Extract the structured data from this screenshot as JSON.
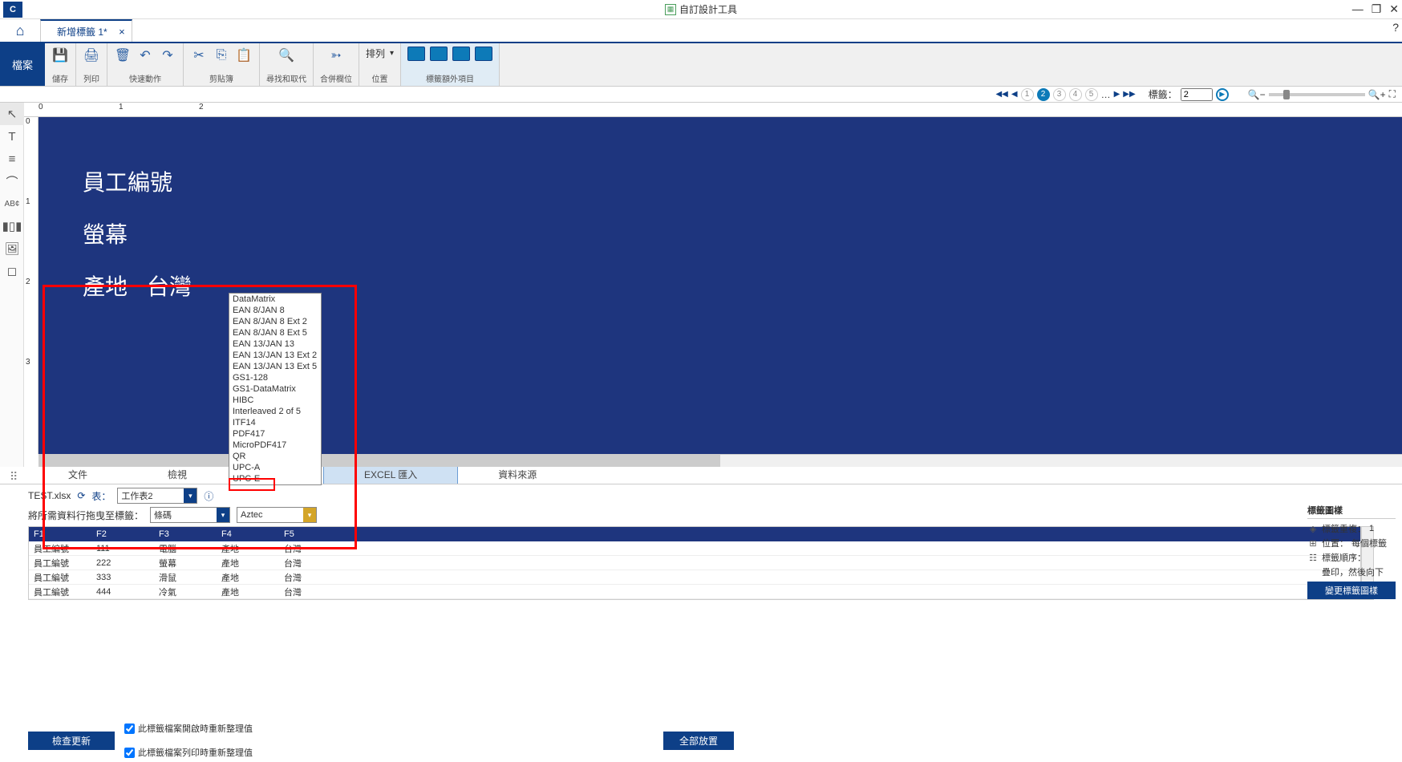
{
  "titlebar": {
    "app_logo": "C",
    "title": "自訂設計工具"
  },
  "tabs": {
    "doc_tab": "新增標籤 1*"
  },
  "ribbon": {
    "file": "檔案",
    "groups": {
      "save": "儲存",
      "print": "列印",
      "quick": "快速動作",
      "clip": "剪貼簿",
      "findrepl": "尋找和取代",
      "merge": "合併欄位",
      "arrange": "排列",
      "pos": "位置",
      "extra": "標籤額外項目"
    }
  },
  "navbar": {
    "label_prompt": "標籤：",
    "label_value": "2"
  },
  "canvas": {
    "text1": "員工編號",
    "text2": "螢幕",
    "text3": "產地",
    "text4": "台灣"
  },
  "barcode_dropdown": {
    "selected": "Aztec",
    "options": [
      "DataMatrix",
      "EAN 8/JAN 8",
      "EAN 8/JAN 8 Ext 2",
      "EAN 8/JAN 8 Ext 5",
      "EAN 13/JAN 13",
      "EAN 13/JAN 13 Ext 2",
      "EAN 13/JAN 13 Ext 5",
      "GS1-128",
      "GS1-DataMatrix",
      "HIBC",
      "Interleaved 2 of 5",
      "ITF14",
      "PDF417",
      "MicroPDF417",
      "QR",
      "UPC-A",
      "UPC-E"
    ]
  },
  "bottom_tabs": {
    "t0": "文件",
    "t1": "檢視",
    "t2_active": "EXCEL 匯入",
    "t3": "資料來源"
  },
  "data_panel": {
    "filename": "TEST.xlsx",
    "table_label": "表：",
    "sheet_selected": "工作表2",
    "drag_label": "將所需資料行拖曳至標籤：",
    "format_selected": "條碼"
  },
  "table": {
    "headers": [
      "F1",
      "F2",
      "F3",
      "F4",
      "F5"
    ],
    "rows": [
      [
        "員工編號",
        "111",
        "電腦",
        "產地",
        "台灣"
      ],
      [
        "員工編號",
        "222",
        "螢幕",
        "產地",
        "台灣"
      ],
      [
        "員工編號",
        "333",
        "滑鼠",
        "產地",
        "台灣"
      ],
      [
        "員工編號",
        "444",
        "冷氣",
        "產地",
        "台灣"
      ]
    ]
  },
  "footer": {
    "check_btn": "檢查更新",
    "chk1": "此標籤檔案開啟時重新整理值",
    "chk2": "此標籤檔案列印時重新整理值",
    "place_btn": "全部放置"
  },
  "side_info": {
    "header": "標籤圖樣",
    "repeat_label": "標籤重複：",
    "repeat_val": "1",
    "pos_label": "位置：",
    "pos_val": "每個標籤",
    "order_label": "標籤順序：",
    "order_val": "疊印，然後向下",
    "change_btn": "變更標籤圖樣"
  }
}
